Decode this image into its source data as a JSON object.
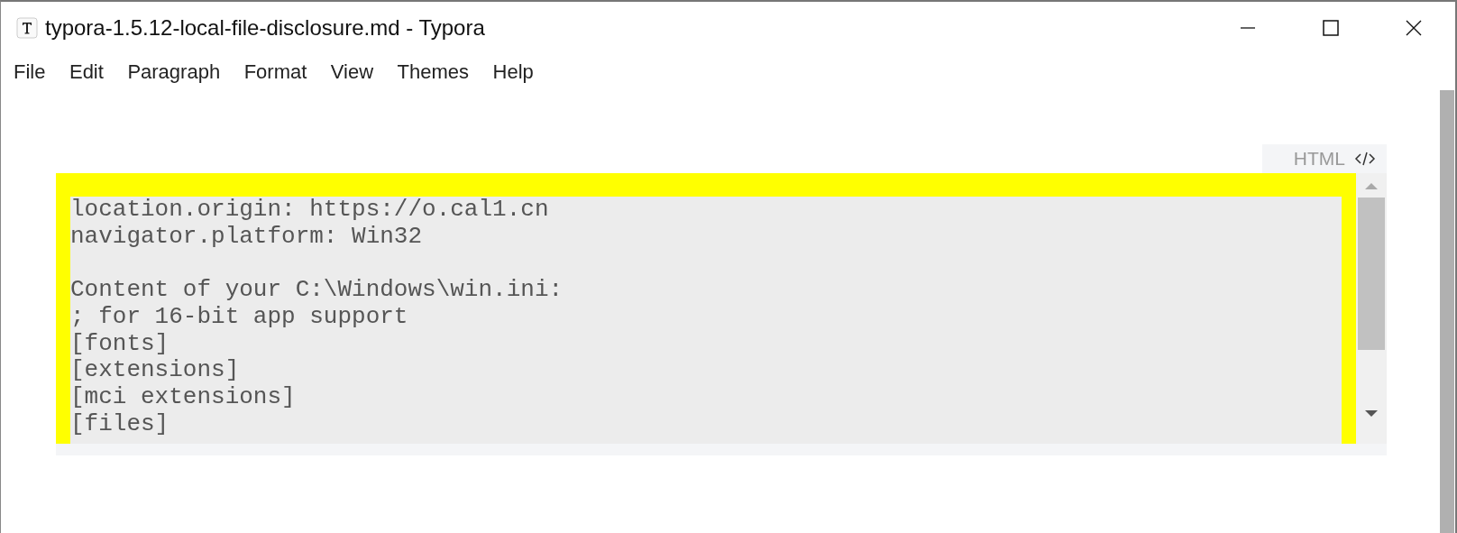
{
  "window": {
    "title": "typora-1.5.12-local-file-disclosure.md - Typora"
  },
  "menu": [
    "File",
    "Edit",
    "Paragraph",
    "Format",
    "View",
    "Themes",
    "Help"
  ],
  "html_block": {
    "label": "HTML",
    "paragraphs": [
      [
        "location.origin: https://o.cal1.cn",
        "navigator.platform: Win32"
      ],
      [
        "Content of your C:\\Windows\\win.ini:",
        "; for 16-bit app support",
        "[fonts]",
        "[extensions]",
        "[mci extensions]",
        "[files]"
      ]
    ]
  }
}
